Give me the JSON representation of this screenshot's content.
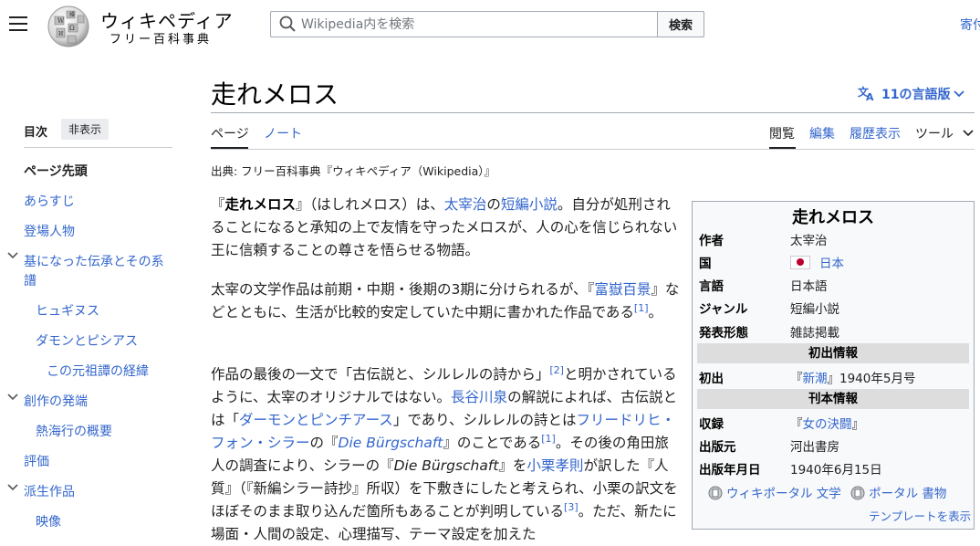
{
  "header": {
    "wordmark": "ウィキペディア",
    "tagline": "フリー百科事典",
    "search_placeholder": "Wikipedia内を検索",
    "search_button": "検索",
    "donate": "寄付"
  },
  "title": "走れメロス",
  "languages_label": "11の言語版",
  "tabs": {
    "page": "ページ",
    "talk": "ノート",
    "read": "閲覧",
    "edit": "編集",
    "history": "履歴表示",
    "tools": "ツール"
  },
  "from_line": "出典: フリー百科事典『ウィキペディア（Wikipedia）』",
  "toc": {
    "title": "目次",
    "hide": "非表示",
    "items": [
      "ページ先頭",
      "あらすじ",
      "登場人物",
      "基になった伝承とその系",
      "譜",
      "ヒュギヌス",
      "ダモンとピシアス",
      "この元祖譚の経緯",
      "創作の発端",
      "熱海行の概要",
      "評価",
      "派生作品",
      "映像"
    ]
  },
  "article": {
    "p1": {
      "a": "『",
      "b": "走れメロス",
      "c": "』（はしれメロス）は、",
      "d": "太宰治",
      "e": "の",
      "f": "短編小説",
      "g": "。自分が処刑されることになると承知の上で友情を守ったメロスが、人の心を信じられない王に信頼することの尊さを悟らせる物語。"
    },
    "p2": {
      "a": "太宰の文学作品は前期・中期・後期の3期に分けられるが、『",
      "b": "富嶽百景",
      "c": "』などとともに、生活が比較的安定していた中期に書かれた作品である",
      "ref": "[1]",
      "d": "。"
    },
    "p3": {
      "a": "作品の最後の一文で「古伝説と、シルレルの詩から」",
      "ref1": "[2]",
      "b": "と明かされているように、太宰のオリジナルではない。",
      "c": "長谷川泉",
      "d": "の解説によれば、古伝説とは「",
      "e": "ダーモンとピンチアース",
      "f": "」であり、シルレルの詩とは",
      "g": "フリードリヒ・フォン・シラー",
      "h": "の『",
      "i": "Die Bürgschaft",
      "j": "』のことである",
      "ref2": "[1]",
      "k": "。その後の角田旅人の調査により、シラーの『",
      "l": "Die Bürgschaft",
      "m": "』を",
      "n": "小栗孝則",
      "o": "が訳した『人質』（『新編シラー詩抄』所収）を下敷きにしたと考えられ、小栗の訳文をほぼそのまま取り込んだ箇所もあることが判明している",
      "ref3": "[3]",
      "p": "。ただ、新たに場面・人間の設定、心理描写、テーマ設定を加えた"
    }
  },
  "infobox": {
    "title": "走れメロス",
    "rows": [
      {
        "label": "作者",
        "value": "太宰治"
      },
      {
        "label": "国",
        "value": "日本"
      },
      {
        "label": "言語",
        "value": "日本語"
      },
      {
        "label": "ジャンル",
        "value": "短編小説"
      },
      {
        "label": "発表形態",
        "value": "雑誌掲載"
      }
    ],
    "section1": "初出情報",
    "first_pub": {
      "label": "初出",
      "a": "『",
      "b": "新潮",
      "c": "』1940年5月号"
    },
    "section2": "刊本情報",
    "collected": {
      "label": "収録",
      "a": "『",
      "b": "女の決闘",
      "c": "』"
    },
    "publisher": {
      "label": "出版元",
      "value": "河出書房"
    },
    "pub_date": {
      "label": "出版年月日",
      "value": "1940年6月15日"
    },
    "portals": [
      "ウィキポータル 文学",
      "ポータル 書物"
    ],
    "template_link": "テンプレートを表示"
  },
  "colors": {
    "link": "#3366cc",
    "text": "#202122",
    "infobox_bg": "#f8f9fa",
    "infobox_header": "#dddddd",
    "flag_red": "#bc002d"
  },
  "icons": [
    "menu-icon",
    "wikipedia-globe-logo",
    "search-icon",
    "translate-icon",
    "chevron-down-icon",
    "portal-icon"
  ]
}
